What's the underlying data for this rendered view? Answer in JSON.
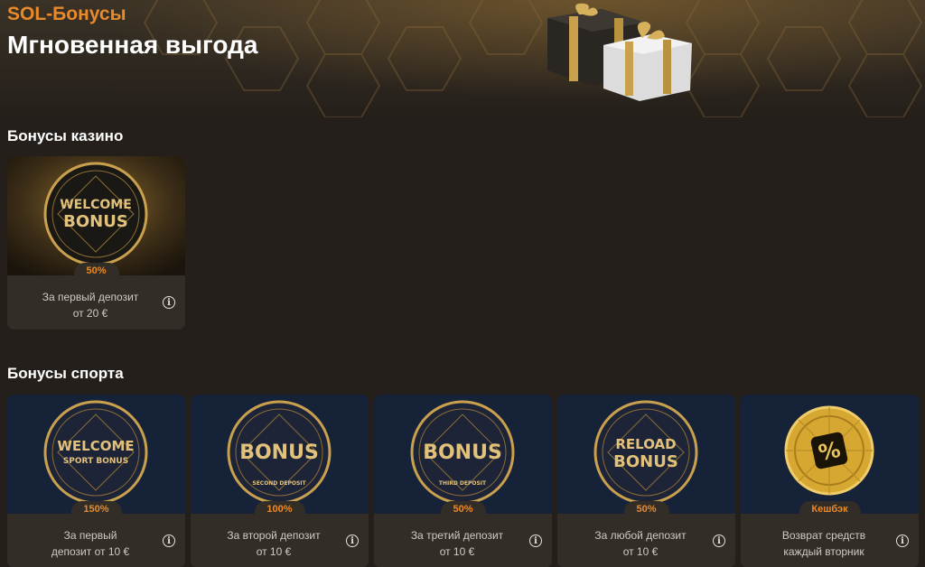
{
  "header": {
    "brand": "SOL-Бонусы",
    "title": "Мгновенная выгода"
  },
  "casino": {
    "section_title": "Бонусы казино",
    "cards": [
      {
        "badge_line1": "WELCOME",
        "badge_line2": "BONUS",
        "badge_sub": "",
        "percent": "50%",
        "desc_line1": "За первый депозит",
        "desc_line2": "от 20 €",
        "theme": "gold"
      }
    ]
  },
  "sport": {
    "section_title": "Бонусы спорта",
    "cards": [
      {
        "badge_line1": "WELCOME",
        "badge_line2": "SPORT BONUS",
        "badge_sub": "",
        "percent": "150%",
        "desc_line1": "За первый",
        "desc_line2": "депозит от 10 €"
      },
      {
        "badge_line1": "BONUS",
        "badge_line2": "",
        "badge_sub": "SECOND DEPOSIT",
        "percent": "100%",
        "desc_line1": "За второй депозит",
        "desc_line2": "от 10 €"
      },
      {
        "badge_line1": "BONUS",
        "badge_line2": "",
        "badge_sub": "THIRD DEPOSIT",
        "percent": "50%",
        "desc_line1": "За третий депозит",
        "desc_line2": "от 10 €"
      },
      {
        "badge_line1": "RELOAD",
        "badge_line2": "BONUS",
        "badge_sub": "",
        "percent": "50%",
        "desc_line1": "За любой депозит",
        "desc_line2": "от 10 €"
      },
      {
        "badge_line1": "%",
        "badge_line2": "",
        "badge_sub": "",
        "percent": "Кешбэк",
        "desc_line1": "Возврат средств",
        "desc_line2": "каждый вторник"
      }
    ]
  },
  "icons": {
    "info": "info-icon"
  },
  "colors": {
    "accent": "#e98a2a",
    "background": "#241f1a",
    "card": "#332d27",
    "gold": "#d9b25a",
    "sport_bg": "#1c2a45"
  }
}
